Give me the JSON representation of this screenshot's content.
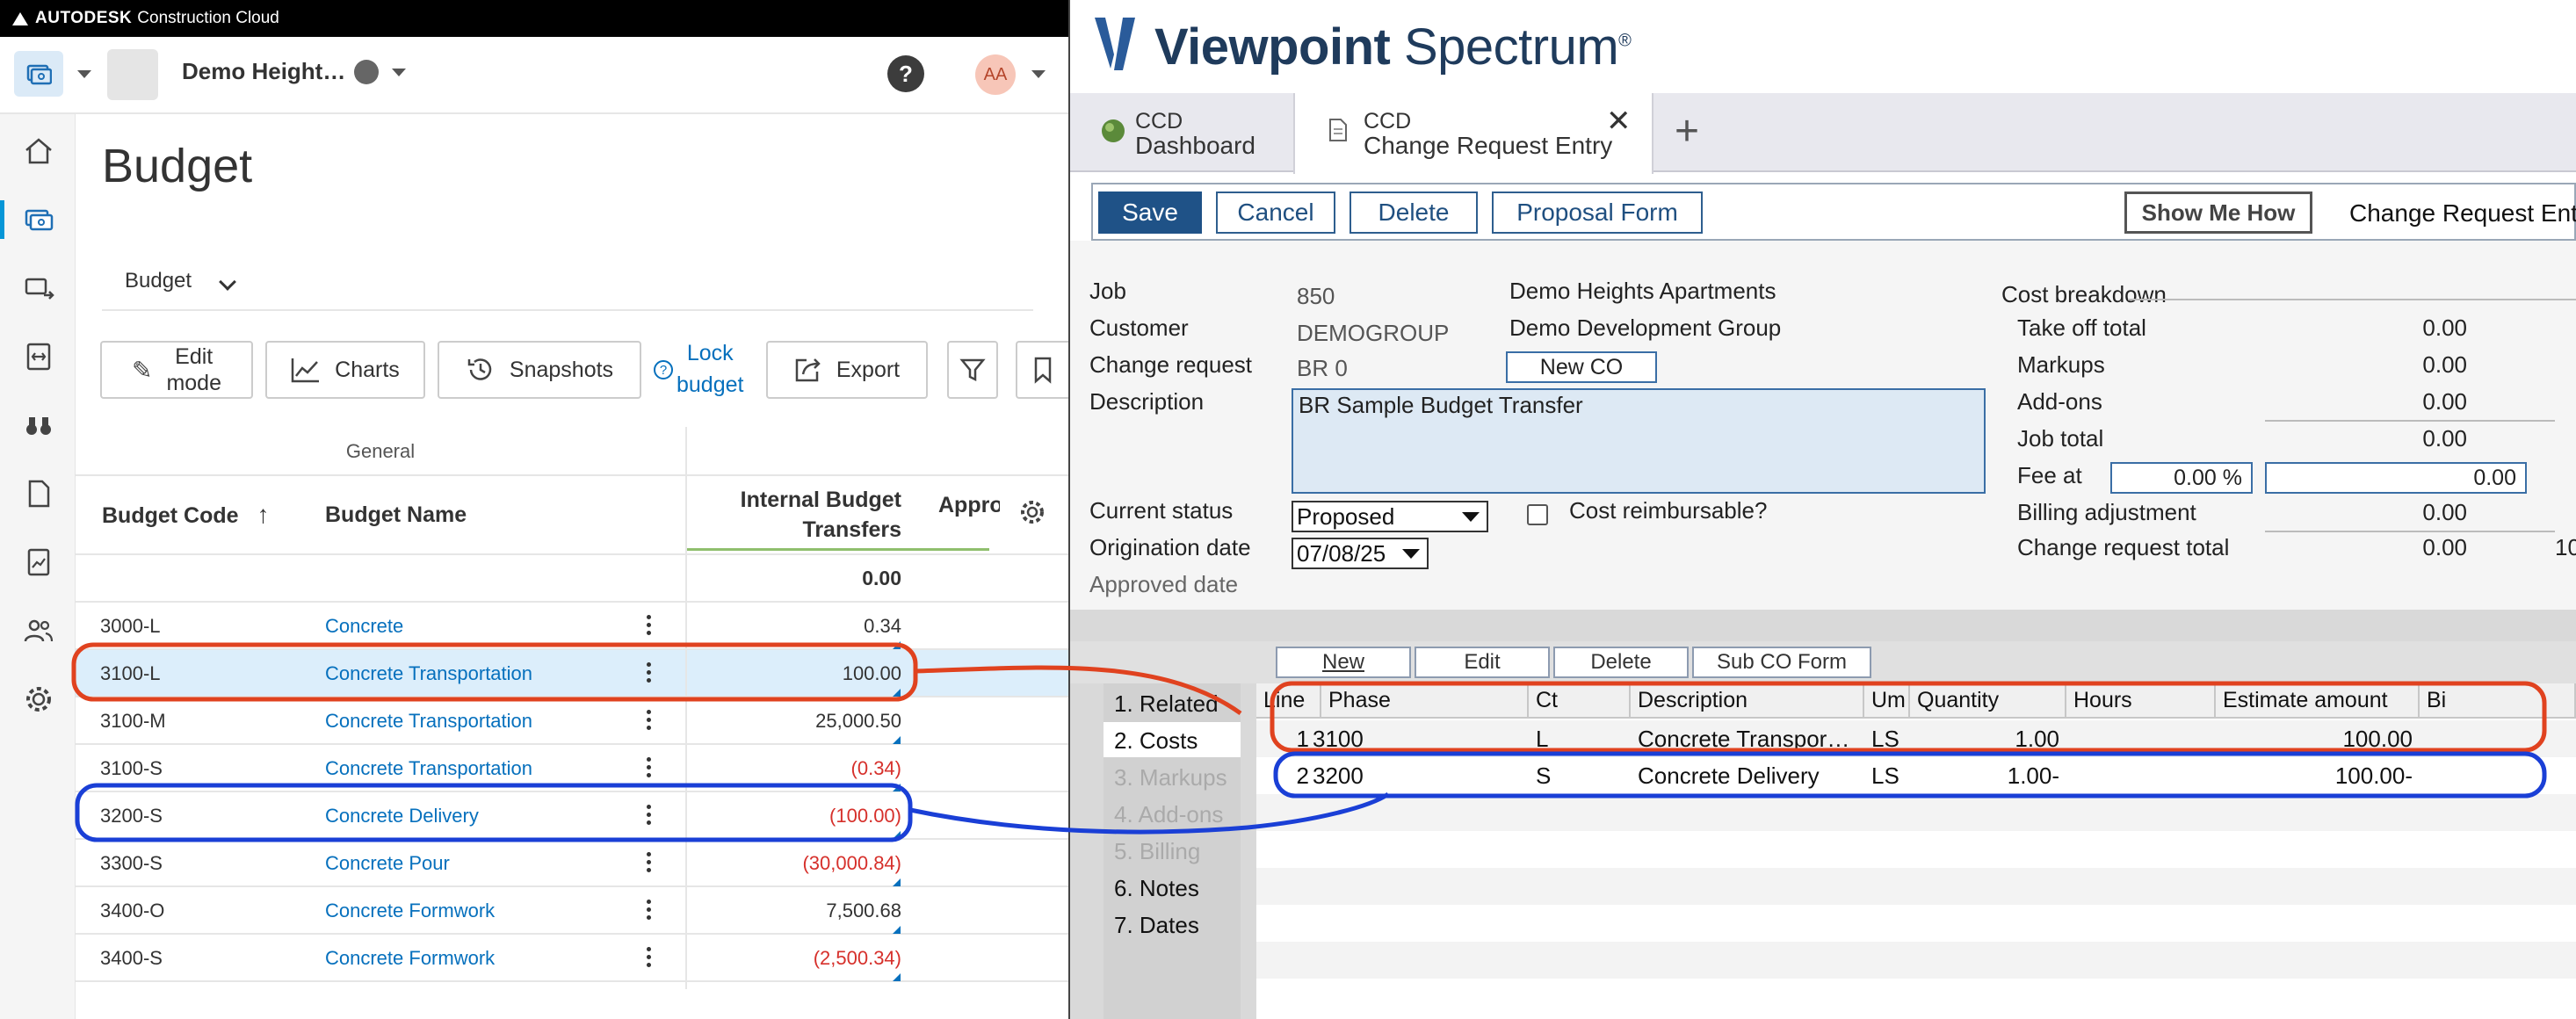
{
  "acc": {
    "brand_bold": "AUTODESK",
    "brand_rest": "Construction Cloud",
    "project_name": "Demo Height…",
    "help_label": "?",
    "avatar_initials": "AA",
    "page_title": "Budget",
    "view_dropdown": "Budget",
    "toolbar": {
      "edit_mode": "Edit\nmode",
      "charts": "Charts",
      "snapshots": "Snapshots",
      "lock_budget": "Lock\nbudget",
      "export": "Export"
    },
    "grid": {
      "group_label": "General",
      "col_code": "Budget Code",
      "col_name": "Budget Name",
      "col_ibt": "Internal Budget\nTransfers",
      "col_approved": "Appro",
      "total": "0.00",
      "rows": [
        {
          "code": "3000-L",
          "name": "Concrete",
          "value": "0.34",
          "negative": false
        },
        {
          "code": "3100-L",
          "name": "Concrete Transportation",
          "value": "100.00",
          "negative": false
        },
        {
          "code": "3100-M",
          "name": "Concrete Transportation",
          "value": "25,000.50",
          "negative": false
        },
        {
          "code": "3100-S",
          "name": "Concrete Transportation",
          "value": "(0.34)",
          "negative": true
        },
        {
          "code": "3200-S",
          "name": "Concrete Delivery",
          "value": "(100.00)",
          "negative": true
        },
        {
          "code": "3300-S",
          "name": "Concrete Pour",
          "value": "(30,000.84)",
          "negative": true
        },
        {
          "code": "3400-O",
          "name": "Concrete Formwork",
          "value": "7,500.68",
          "negative": false
        },
        {
          "code": "3400-S",
          "name": "Concrete Formwork",
          "value": "(2,500.34)",
          "negative": true
        }
      ]
    }
  },
  "vp": {
    "brand_bold": "Viewpoint",
    "brand_rest": " Spectrum",
    "brand_mark": "®",
    "tabs": [
      {
        "line1": "CCD",
        "line2": "Dashboard"
      },
      {
        "line1": "CCD",
        "line2": "Change Request Entry"
      }
    ],
    "toolbar": {
      "save": "Save",
      "cancel": "Cancel",
      "delete": "Delete",
      "proposal_form": "Proposal Form",
      "show_me_how": "Show Me How",
      "form_title": "Change Request Entry"
    },
    "form": {
      "job_label": "Job",
      "job_value": "850",
      "job_name": "Demo Heights Apartments",
      "customer_label": "Customer",
      "customer_value": "DEMOGROUP",
      "customer_name": "Demo Development Group",
      "cr_label": "Change request",
      "cr_value": "BR 0",
      "new_co": "New CO",
      "desc_label": "Description",
      "desc_value": "BR Sample Budget Transfer",
      "status_label": "Current status",
      "status_value": "Proposed",
      "reimb_label": "Cost reimbursable?",
      "orig_label": "Origination date",
      "orig_value": "07/08/25",
      "approved_label": "Approved date"
    },
    "cost_breakdown": {
      "title": "Cost breakdown",
      "take_off_label": "Take off total",
      "take_off": "0.00",
      "markups_label": "Markups",
      "markups": "0.00",
      "addons_label": "Add-ons",
      "addons": "0.00",
      "job_total_label": "Job total",
      "job_total": "0.00",
      "fee_label": "Fee at",
      "fee_pct": "0.00 %",
      "fee_amt": "0.00",
      "billing_adj_label": "Billing adjustment",
      "billing_adj": "0.00",
      "cr_total_label": "Change request total",
      "cr_total": "0.00",
      "cut_value": "10"
    },
    "grid_toolbar": {
      "new": "New",
      "edit": "Edit",
      "delete": "Delete",
      "sub_co_form": "Sub CO Form"
    },
    "side_tabs": [
      {
        "label": "1. Related",
        "state": "on"
      },
      {
        "label": "2. Costs",
        "state": "current"
      },
      {
        "label": "3. Markups",
        "state": "dim"
      },
      {
        "label": "4. Add-ons",
        "state": "dim"
      },
      {
        "label": "5. Billing",
        "state": "dim"
      },
      {
        "label": "6. Notes",
        "state": "on"
      },
      {
        "label": "7. Dates",
        "state": "on"
      }
    ],
    "grid": {
      "headers": [
        "Line",
        "Phase",
        "Ct",
        "Description",
        "Um",
        "Quantity",
        "Hours",
        "Estimate amount",
        "Bi"
      ],
      "rows": [
        {
          "line": "1",
          "phase": "3100",
          "ct": "L",
          "desc": "Concrete Transpor…",
          "um": "LS",
          "qty": "1.00",
          "hours": "",
          "amount": "100.00"
        },
        {
          "line": "2",
          "phase": "3200",
          "ct": "S",
          "desc": "Concrete Delivery",
          "um": "LS",
          "qty": "1.00-",
          "hours": "",
          "amount": "100.00-"
        }
      ]
    }
  },
  "annotation_colors": {
    "red": "#e0421f",
    "blue": "#1a3fd6"
  }
}
